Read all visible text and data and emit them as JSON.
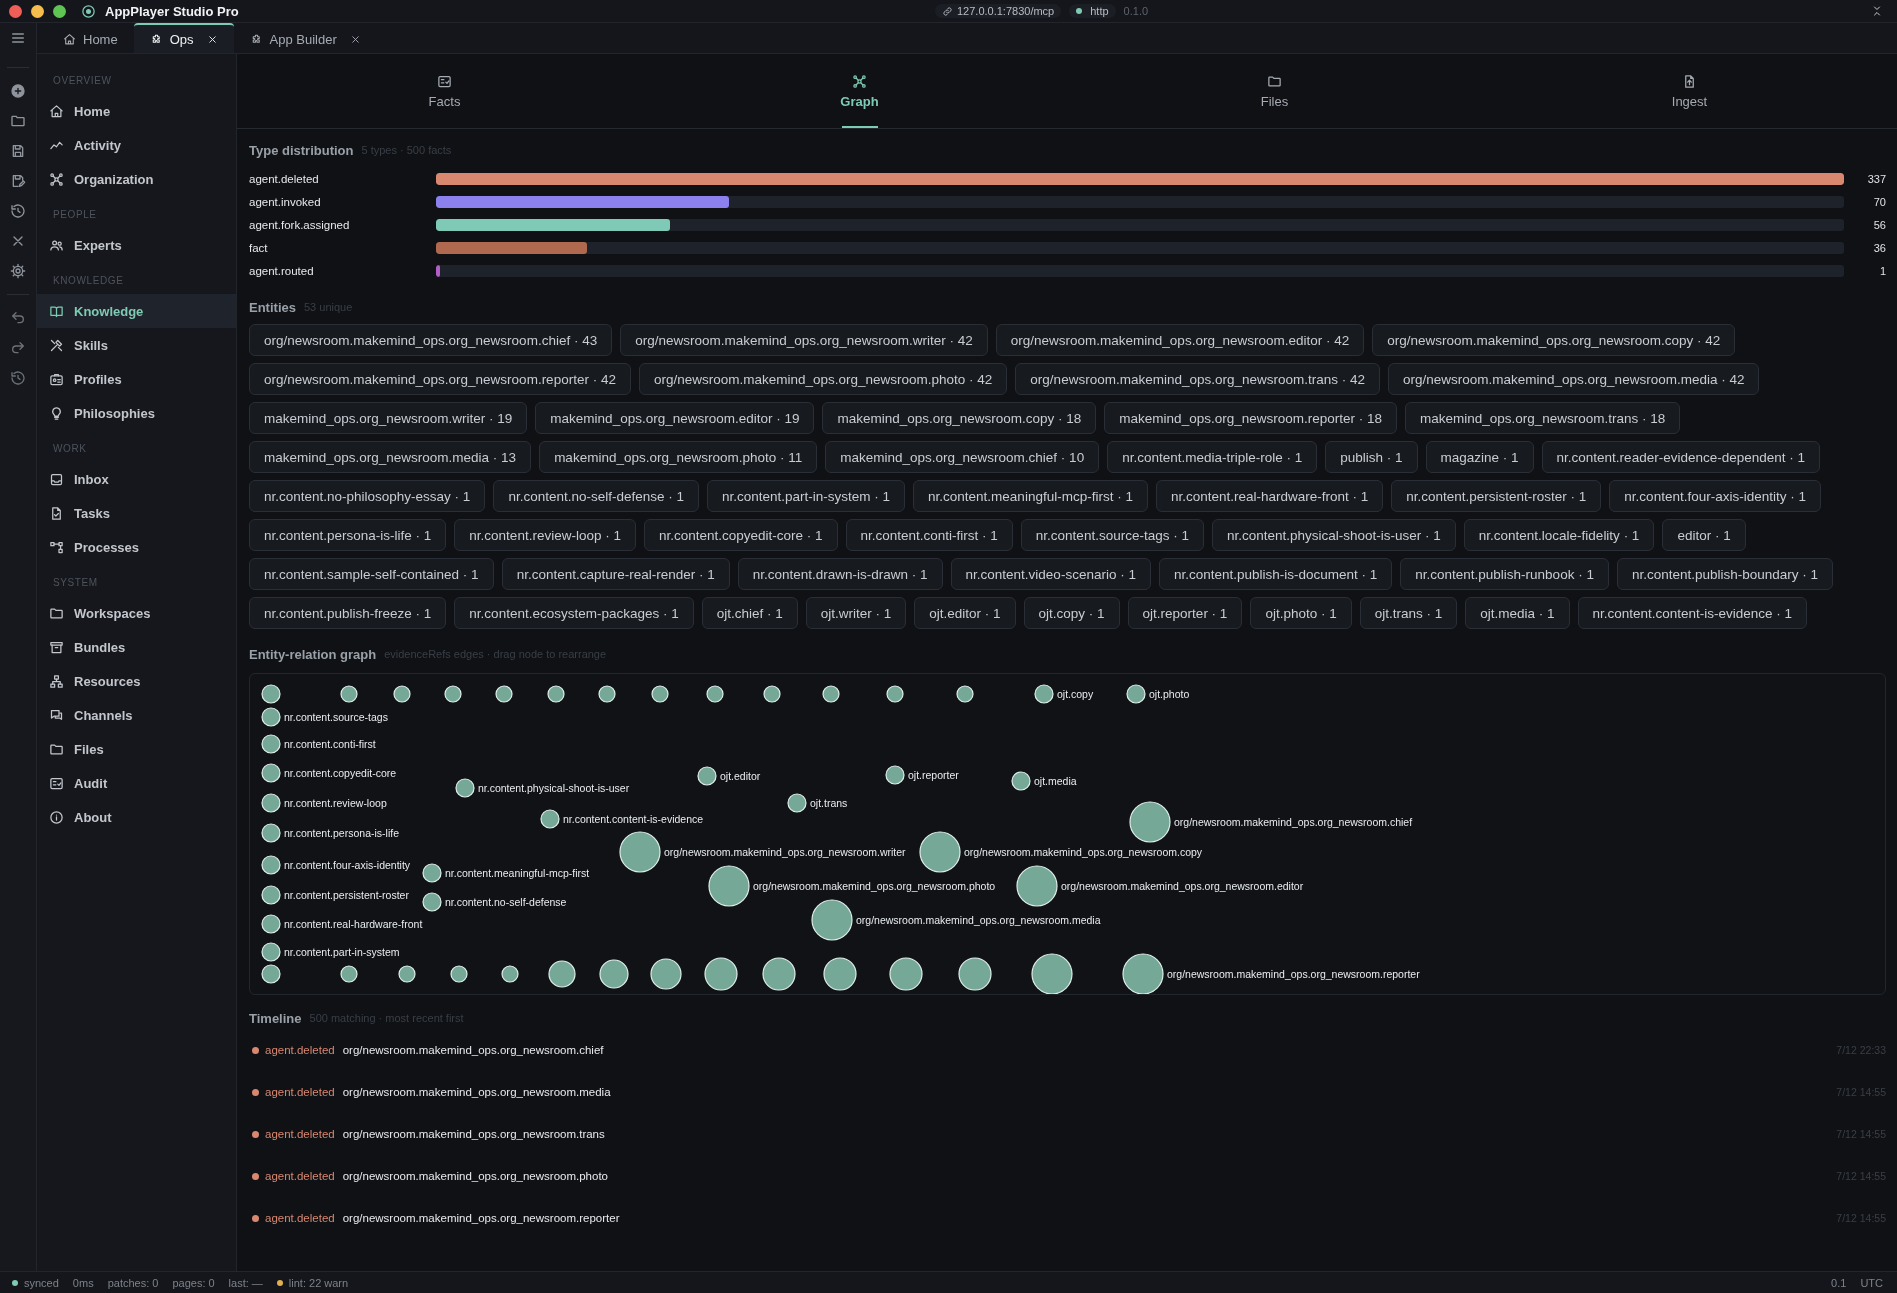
{
  "window": {
    "title": "AppPlayer Studio Pro",
    "endpoint": "127.0.0.1:7830/mcp",
    "transport": "http",
    "version": "0.1.0"
  },
  "tabs": [
    {
      "label": "Home",
      "selected": false,
      "closable": false
    },
    {
      "label": "Ops",
      "selected": true,
      "closable": true
    },
    {
      "label": "App Builder",
      "selected": false,
      "closable": true
    }
  ],
  "sidebar": {
    "sections": [
      {
        "title": "OVERVIEW",
        "items": [
          {
            "label": "Home",
            "selected": false
          },
          {
            "label": "Activity",
            "selected": false
          },
          {
            "label": "Organization",
            "selected": false
          }
        ]
      },
      {
        "title": "PEOPLE",
        "items": [
          {
            "label": "Experts",
            "selected": false
          }
        ]
      },
      {
        "title": "KNOWLEDGE",
        "items": [
          {
            "label": "Knowledge",
            "selected": true
          },
          {
            "label": "Skills",
            "selected": false
          },
          {
            "label": "Profiles",
            "selected": false
          },
          {
            "label": "Philosophies",
            "selected": false
          }
        ]
      },
      {
        "title": "WORK",
        "items": [
          {
            "label": "Inbox",
            "selected": false
          },
          {
            "label": "Tasks",
            "selected": false
          },
          {
            "label": "Processes",
            "selected": false
          }
        ]
      },
      {
        "title": "SYSTEM",
        "items": [
          {
            "label": "Workspaces",
            "selected": false
          },
          {
            "label": "Bundles",
            "selected": false
          },
          {
            "label": "Resources",
            "selected": false
          },
          {
            "label": "Channels",
            "selected": false
          },
          {
            "label": "Files",
            "selected": false
          },
          {
            "label": "Audit",
            "selected": false
          },
          {
            "label": "About",
            "selected": false
          }
        ]
      }
    ]
  },
  "view_tabs": [
    {
      "label": "Facts",
      "selected": false
    },
    {
      "label": "Graph",
      "selected": true
    },
    {
      "label": "Files",
      "selected": false
    },
    {
      "label": "Ingest",
      "selected": false
    }
  ],
  "type_distribution": {
    "title": "Type distribution",
    "summary": "5 types · 500 facts",
    "rows": [
      {
        "name": "agent.deleted",
        "level": 1,
        "count": "337",
        "color": "#d98870"
      },
      {
        "name": "agent.invoked",
        "level": 0.208,
        "count": "70",
        "color": "#8b80ee"
      },
      {
        "name": "agent.fork.assigned",
        "level": 0.166,
        "count": "56",
        "color": "#7ecab6"
      },
      {
        "name": "fact",
        "level": 0.107,
        "count": "36",
        "color": "#b0684f"
      },
      {
        "name": "agent.routed",
        "level": 0.003,
        "count": "1",
        "color": "#b45cc8"
      }
    ]
  },
  "entities": {
    "title": "Entities",
    "summary": "53 unique",
    "items": [
      "org/newsroom.makemind_ops.org_newsroom.chief · 43",
      "org/newsroom.makemind_ops.org_newsroom.writer · 42",
      "org/newsroom.makemind_ops.org_newsroom.editor · 42",
      "org/newsroom.makemind_ops.org_newsroom.copy · 42",
      "org/newsroom.makemind_ops.org_newsroom.reporter · 42",
      "org/newsroom.makemind_ops.org_newsroom.photo · 42",
      "org/newsroom.makemind_ops.org_newsroom.trans · 42",
      "org/newsroom.makemind_ops.org_newsroom.media · 42",
      "makemind_ops.org_newsroom.writer · 19",
      "makemind_ops.org_newsroom.editor · 19",
      "makemind_ops.org_newsroom.copy · 18",
      "makemind_ops.org_newsroom.reporter · 18",
      "makemind_ops.org_newsroom.trans · 18",
      "makemind_ops.org_newsroom.media · 13",
      "makemind_ops.org_newsroom.photo · 11",
      "makemind_ops.org_newsroom.chief · 10",
      "nr.content.media-triple-role · 1",
      "publish · 1",
      "magazine · 1",
      "nr.content.reader-evidence-dependent · 1",
      "nr.content.no-philosophy-essay · 1",
      "nr.content.no-self-defense · 1",
      "nr.content.part-in-system · 1",
      "nr.content.meaningful-mcp-first · 1",
      "nr.content.real-hardware-front · 1",
      "nr.content.persistent-roster · 1",
      "nr.content.four-axis-identity · 1",
      "nr.content.persona-is-life · 1",
      "nr.content.review-loop · 1",
      "nr.content.copyedit-core · 1",
      "nr.content.conti-first · 1",
      "nr.content.source-tags · 1",
      "nr.content.physical-shoot-is-user · 1",
      "nr.content.locale-fidelity · 1",
      "editor · 1",
      "nr.content.sample-self-contained · 1",
      "nr.content.capture-real-render · 1",
      "nr.content.drawn-is-drawn · 1",
      "nr.content.video-scenario · 1",
      "nr.content.publish-is-document · 1",
      "nr.content.publish-runbook · 1",
      "nr.content.publish-boundary · 1",
      "nr.content.publish-freeze · 1",
      "nr.content.ecosystem-packages · 1",
      "ojt.chief · 1",
      "ojt.writer · 1",
      "ojt.editor · 1",
      "ojt.copy · 1",
      "ojt.reporter · 1",
      "ojt.photo · 1",
      "ojt.trans · 1",
      "ojt.media · 1",
      "nr.content.content-is-evidence · 1"
    ]
  },
  "graph": {
    "title": "Entity-relation graph",
    "summary": "evidenceRefs edges · drag node to rearrange",
    "nodes": [
      {
        "label": "nr.content.source-tags"
      },
      {
        "label": "nr.content.conti-first"
      },
      {
        "label": "nr.content.copyedit-core"
      },
      {
        "label": "nr.content.review-loop"
      },
      {
        "label": "nr.content.persona-is-life"
      },
      {
        "label": "nr.content.four-axis-identity"
      },
      {
        "label": "nr.content.persistent-roster"
      },
      {
        "label": "nr.content.real-hardware-front"
      },
      {
        "label": "nr.content.part-in-system"
      },
      {
        "label": "ojt.copy"
      },
      {
        "label": "ojt.photo"
      },
      {
        "label": "ojt.editor"
      },
      {
        "label": "ojt.reporter"
      },
      {
        "label": "ojt.media"
      },
      {
        "label": "ojt.trans"
      },
      {
        "label": "nr.content.physical-shoot-is-user"
      },
      {
        "label": "nr.content.content-is-evidence"
      },
      {
        "label": "org/newsroom.makemind_ops.org_newsroom.chief"
      },
      {
        "label": "nr.content.meaningful-mcp-first"
      },
      {
        "label": "nr.content.no-self-defense"
      },
      {
        "label": "org/newsroom.makemind_ops.org_newsroom.writer"
      },
      {
        "label": "org/newsroom.makemind_ops.org_newsroom.copy"
      },
      {
        "label": "org/newsroom.makemind_ops.org_newsroom.photo"
      },
      {
        "label": "org/newsroom.makemind_ops.org_newsroom.editor"
      },
      {
        "label": "org/newsroom.makemind_ops.org_newsroom.media"
      },
      {
        "label": "org/newsroom.makemind_ops.org_newsroom.reporter"
      }
    ]
  },
  "timeline": {
    "title": "Timeline",
    "summary": "500 matching · most recent first",
    "rows": [
      {
        "type": "agent.deleted",
        "color": "#d98870",
        "entity": "org/newsroom.makemind_ops.org_newsroom.chief",
        "time": "7/12 22:33"
      },
      {
        "type": "agent.deleted",
        "color": "#d98870",
        "entity": "org/newsroom.makemind_ops.org_newsroom.media",
        "time": "7/12 14:55"
      },
      {
        "type": "agent.deleted",
        "color": "#d98870",
        "entity": "org/newsroom.makemind_ops.org_newsroom.trans",
        "time": "7/12 14:55"
      },
      {
        "type": "agent.deleted",
        "color": "#d98870",
        "entity": "org/newsroom.makemind_ops.org_newsroom.photo",
        "time": "7/12 14:55"
      },
      {
        "type": "agent.deleted",
        "color": "#d98870",
        "entity": "org/newsroom.makemind_ops.org_newsroom.reporter",
        "time": "7/12 14:55"
      }
    ]
  },
  "status_bar": {
    "sync": "synced",
    "latency": "0ms",
    "patches": "patches: 0",
    "pages": "pages: 0",
    "last": "last: —",
    "lint": "lint: 22 warn",
    "zoom": "0.1",
    "timezone": "UTC"
  }
}
